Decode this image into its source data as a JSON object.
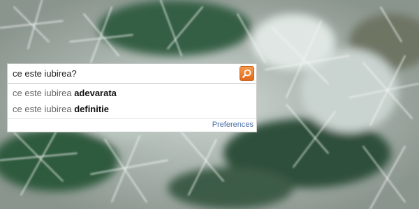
{
  "search": {
    "value": "ce este iubirea?",
    "button_icon": "search-icon"
  },
  "suggestions": [
    {
      "prefix": "ce este iubirea",
      "completion": "adevarata"
    },
    {
      "prefix": "ce este iubirea",
      "completion": "definitie"
    }
  ],
  "preferences_label": "Preferences",
  "colors": {
    "search_button": "#ee7d2d",
    "link": "#4a6fa5",
    "suggestion_prefix": "#666666"
  }
}
